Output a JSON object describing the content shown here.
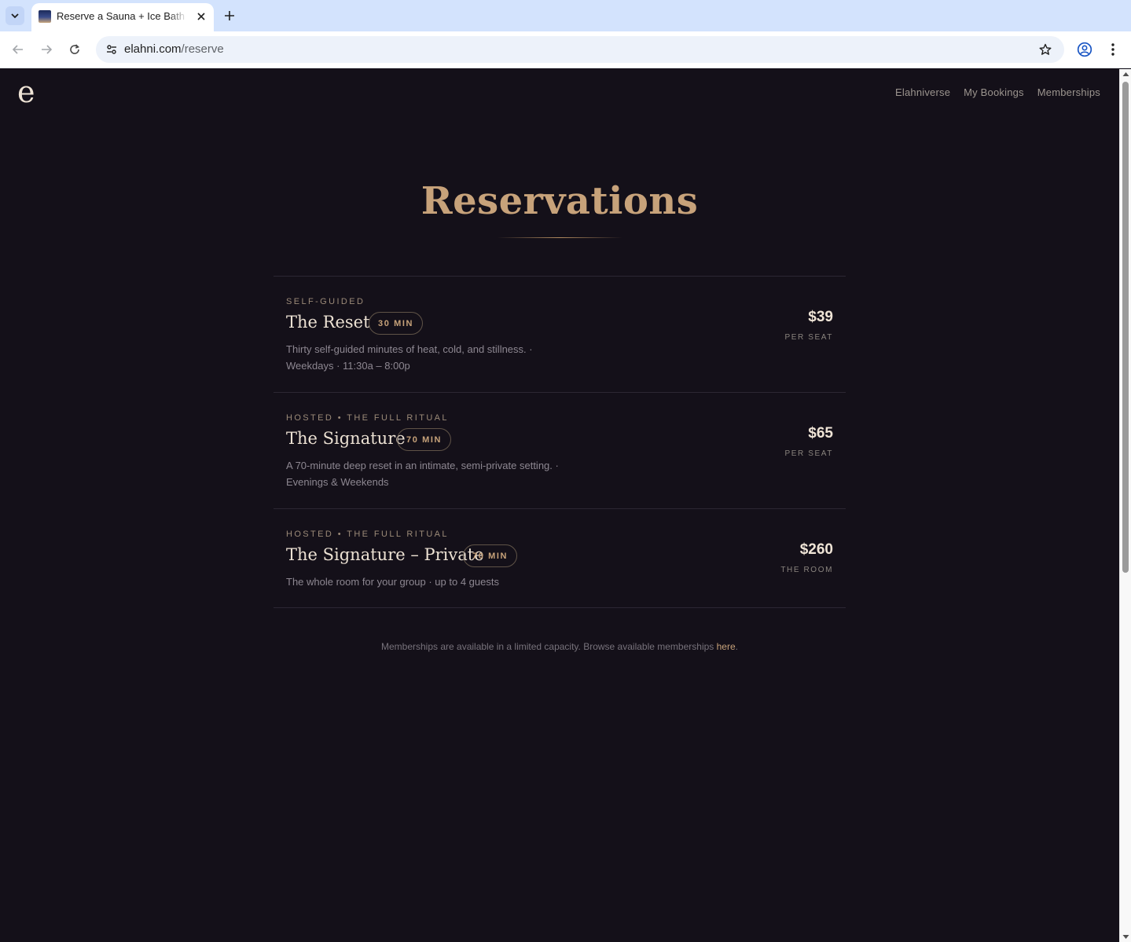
{
  "browser": {
    "tab_title": "Reserve a Sauna + Ice Bath Session",
    "url_host": "elahni.com",
    "url_path": "/reserve"
  },
  "site": {
    "logo": "e",
    "nav": [
      "Elahniverse",
      "My Bookings",
      "Memberships"
    ]
  },
  "page": {
    "title": "Reservations"
  },
  "offerings": [
    {
      "category": "SELF-GUIDED",
      "name": "The Reset",
      "duration": "30 MIN",
      "description": "Thirty self-guided minutes of heat, cold, and stillness. · Weekdays · 11:30a – 8:00p",
      "price": "$39",
      "unit": "PER SEAT"
    },
    {
      "category": "HOSTED • THE FULL RITUAL",
      "name": "The Signature",
      "duration": "70 MIN",
      "description": "A 70-minute deep reset in an intimate, semi-private setting. · Evenings & Weekends",
      "price": "$65",
      "unit": "PER SEAT"
    },
    {
      "category": "HOSTED • THE FULL RITUAL",
      "name": "The Signature – Private",
      "duration": "70 MIN",
      "description": "The whole room for your group · up to 4 guests",
      "price": "$260",
      "unit": "THE ROOM"
    }
  ],
  "footnote": {
    "text": "Memberships are available in a limited capacity. Browse available memberships ",
    "link": "here",
    "end": "."
  }
}
